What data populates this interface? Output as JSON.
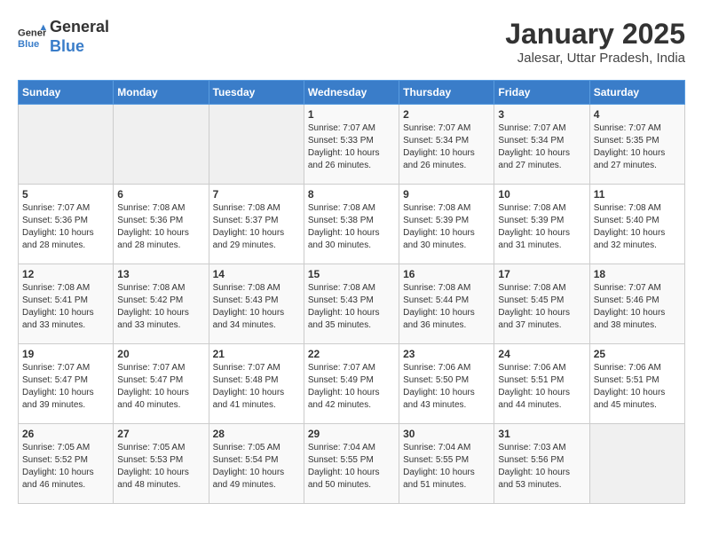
{
  "header": {
    "logo_line1": "General",
    "logo_line2": "Blue",
    "month": "January 2025",
    "location": "Jalesar, Uttar Pradesh, India"
  },
  "weekdays": [
    "Sunday",
    "Monday",
    "Tuesday",
    "Wednesday",
    "Thursday",
    "Friday",
    "Saturday"
  ],
  "weeks": [
    [
      null,
      null,
      null,
      {
        "day": 1,
        "sunrise": "7:07 AM",
        "sunset": "5:33 PM",
        "daylight": "10 hours and 26 minutes."
      },
      {
        "day": 2,
        "sunrise": "7:07 AM",
        "sunset": "5:34 PM",
        "daylight": "10 hours and 26 minutes."
      },
      {
        "day": 3,
        "sunrise": "7:07 AM",
        "sunset": "5:34 PM",
        "daylight": "10 hours and 27 minutes."
      },
      {
        "day": 4,
        "sunrise": "7:07 AM",
        "sunset": "5:35 PM",
        "daylight": "10 hours and 27 minutes."
      }
    ],
    [
      {
        "day": 5,
        "sunrise": "7:07 AM",
        "sunset": "5:36 PM",
        "daylight": "10 hours and 28 minutes."
      },
      {
        "day": 6,
        "sunrise": "7:08 AM",
        "sunset": "5:36 PM",
        "daylight": "10 hours and 28 minutes."
      },
      {
        "day": 7,
        "sunrise": "7:08 AM",
        "sunset": "5:37 PM",
        "daylight": "10 hours and 29 minutes."
      },
      {
        "day": 8,
        "sunrise": "7:08 AM",
        "sunset": "5:38 PM",
        "daylight": "10 hours and 30 minutes."
      },
      {
        "day": 9,
        "sunrise": "7:08 AM",
        "sunset": "5:39 PM",
        "daylight": "10 hours and 30 minutes."
      },
      {
        "day": 10,
        "sunrise": "7:08 AM",
        "sunset": "5:39 PM",
        "daylight": "10 hours and 31 minutes."
      },
      {
        "day": 11,
        "sunrise": "7:08 AM",
        "sunset": "5:40 PM",
        "daylight": "10 hours and 32 minutes."
      }
    ],
    [
      {
        "day": 12,
        "sunrise": "7:08 AM",
        "sunset": "5:41 PM",
        "daylight": "10 hours and 33 minutes."
      },
      {
        "day": 13,
        "sunrise": "7:08 AM",
        "sunset": "5:42 PM",
        "daylight": "10 hours and 33 minutes."
      },
      {
        "day": 14,
        "sunrise": "7:08 AM",
        "sunset": "5:43 PM",
        "daylight": "10 hours and 34 minutes."
      },
      {
        "day": 15,
        "sunrise": "7:08 AM",
        "sunset": "5:43 PM",
        "daylight": "10 hours and 35 minutes."
      },
      {
        "day": 16,
        "sunrise": "7:08 AM",
        "sunset": "5:44 PM",
        "daylight": "10 hours and 36 minutes."
      },
      {
        "day": 17,
        "sunrise": "7:08 AM",
        "sunset": "5:45 PM",
        "daylight": "10 hours and 37 minutes."
      },
      {
        "day": 18,
        "sunrise": "7:07 AM",
        "sunset": "5:46 PM",
        "daylight": "10 hours and 38 minutes."
      }
    ],
    [
      {
        "day": 19,
        "sunrise": "7:07 AM",
        "sunset": "5:47 PM",
        "daylight": "10 hours and 39 minutes."
      },
      {
        "day": 20,
        "sunrise": "7:07 AM",
        "sunset": "5:47 PM",
        "daylight": "10 hours and 40 minutes."
      },
      {
        "day": 21,
        "sunrise": "7:07 AM",
        "sunset": "5:48 PM",
        "daylight": "10 hours and 41 minutes."
      },
      {
        "day": 22,
        "sunrise": "7:07 AM",
        "sunset": "5:49 PM",
        "daylight": "10 hours and 42 minutes."
      },
      {
        "day": 23,
        "sunrise": "7:06 AM",
        "sunset": "5:50 PM",
        "daylight": "10 hours and 43 minutes."
      },
      {
        "day": 24,
        "sunrise": "7:06 AM",
        "sunset": "5:51 PM",
        "daylight": "10 hours and 44 minutes."
      },
      {
        "day": 25,
        "sunrise": "7:06 AM",
        "sunset": "5:51 PM",
        "daylight": "10 hours and 45 minutes."
      }
    ],
    [
      {
        "day": 26,
        "sunrise": "7:05 AM",
        "sunset": "5:52 PM",
        "daylight": "10 hours and 46 minutes."
      },
      {
        "day": 27,
        "sunrise": "7:05 AM",
        "sunset": "5:53 PM",
        "daylight": "10 hours and 48 minutes."
      },
      {
        "day": 28,
        "sunrise": "7:05 AM",
        "sunset": "5:54 PM",
        "daylight": "10 hours and 49 minutes."
      },
      {
        "day": 29,
        "sunrise": "7:04 AM",
        "sunset": "5:55 PM",
        "daylight": "10 hours and 50 minutes."
      },
      {
        "day": 30,
        "sunrise": "7:04 AM",
        "sunset": "5:55 PM",
        "daylight": "10 hours and 51 minutes."
      },
      {
        "day": 31,
        "sunrise": "7:03 AM",
        "sunset": "5:56 PM",
        "daylight": "10 hours and 53 minutes."
      },
      null
    ]
  ],
  "labels": {
    "sunrise": "Sunrise:",
    "sunset": "Sunset:",
    "daylight": "Daylight:"
  }
}
